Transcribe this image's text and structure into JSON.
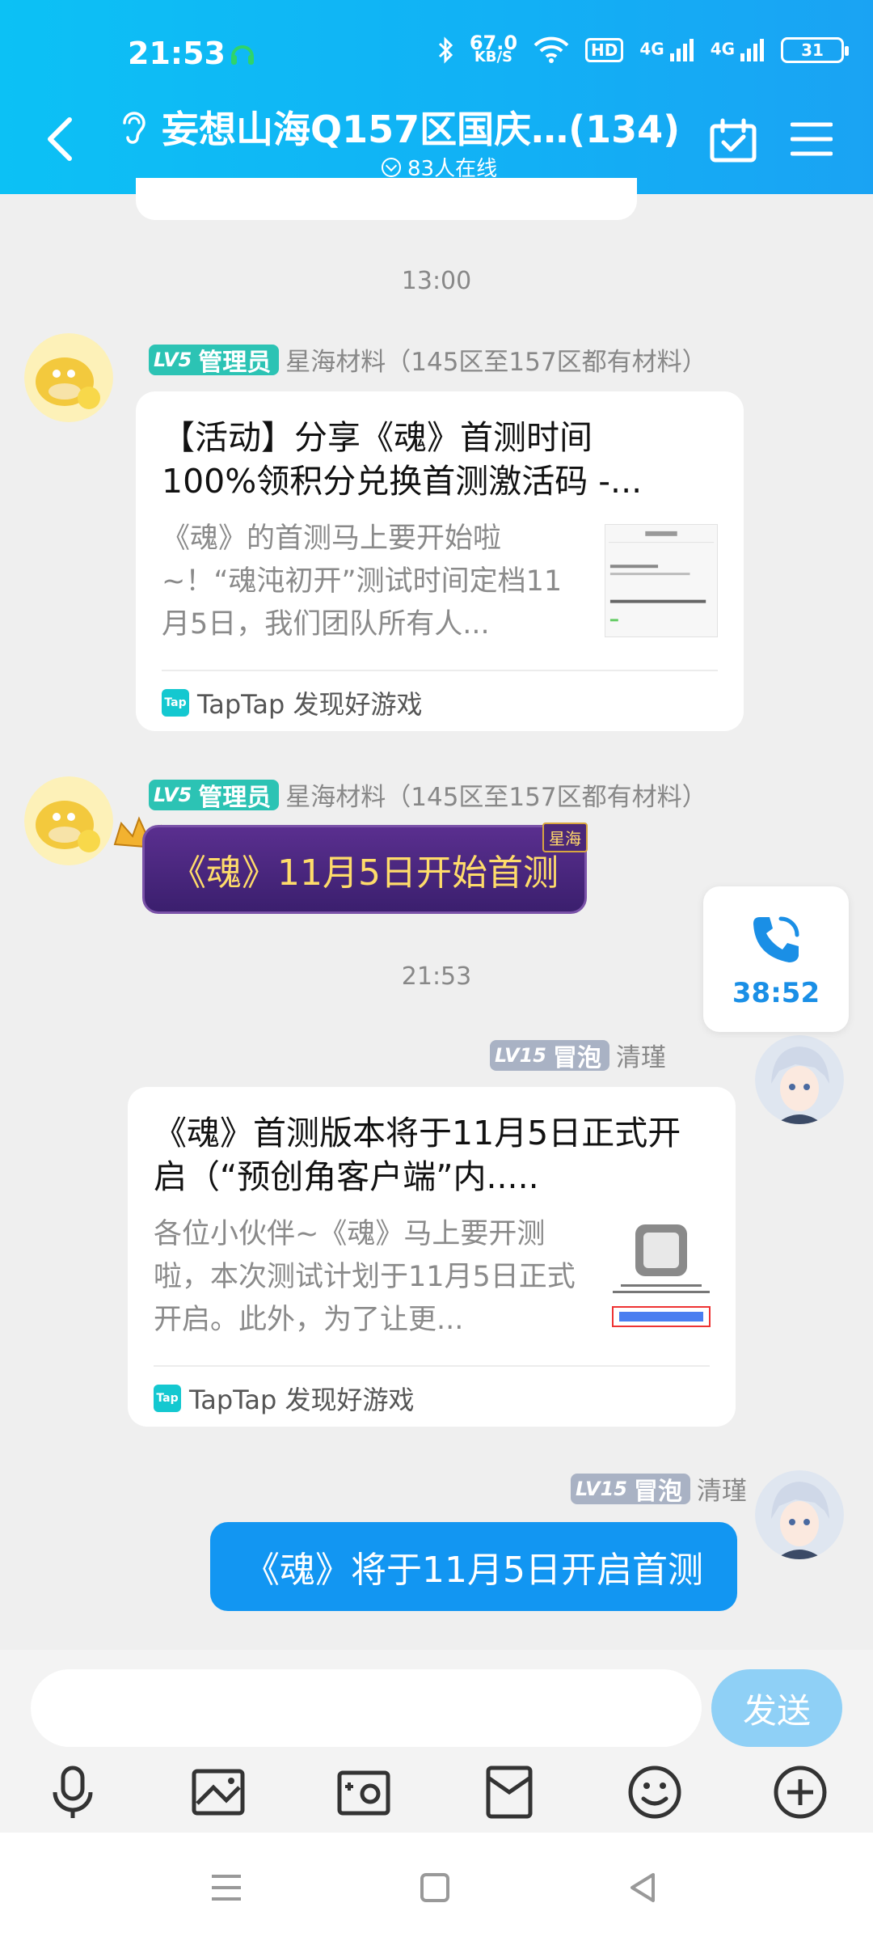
{
  "status_bar": {
    "time": "21:53",
    "net_speed_value": "67.0",
    "net_speed_unit": "KB/S",
    "hd_label": "HD",
    "network_1": "4G",
    "network_2": "4G",
    "battery": "31"
  },
  "header": {
    "title": "妄想山海Q157区国庆…(134)",
    "online": "83人在线"
  },
  "messages": [
    {
      "type": "timestamp",
      "text": "13:00"
    },
    {
      "type": "link_card",
      "level": "LV5",
      "role": "管理员",
      "sender": "星海材料（145区至157区都有材料）",
      "title": "【活动】分享《魂》首测时间100%领积分兑换首测激活码 -...",
      "desc": "《魂》的首测马上要开始啦~！“魂沌初开”测试时间定档11月5日，我们团队所有人...",
      "source": "TapTap 发现好游戏"
    },
    {
      "type": "text",
      "level": "LV5",
      "role": "管理员",
      "sender": "星海材料（145区至157区都有材料）",
      "text": "《魂》11月5日开始首测",
      "bubble_tag": "星海"
    },
    {
      "type": "timestamp",
      "text": "21:53"
    },
    {
      "type": "link_card",
      "level": "LV15",
      "role": "冒泡",
      "sender": "清瑾",
      "title": "《魂》首测版本将于11月5日正式开启（“预创角客户端”内.....",
      "desc": "各位小伙伴~《魂》马上要开测啦，本次测试计划于11月5日正式开启。此外，为了让更...",
      "source": "TapTap 发现好游戏"
    },
    {
      "type": "text",
      "level": "LV15",
      "role": "冒泡",
      "sender": "清瑾",
      "text": "《魂》将于11月5日开启首测"
    }
  ],
  "call": {
    "duration": "38:52"
  },
  "input": {
    "value": "",
    "send_label": "发送"
  },
  "tap_logo": "Tap",
  "colors": {
    "header": "#12b0f5",
    "admin_badge": "#2cc3b4",
    "bubble_badge": "#a9b2c4",
    "self_bubble": "#1296f2",
    "send_button": "#8fd0f6"
  }
}
